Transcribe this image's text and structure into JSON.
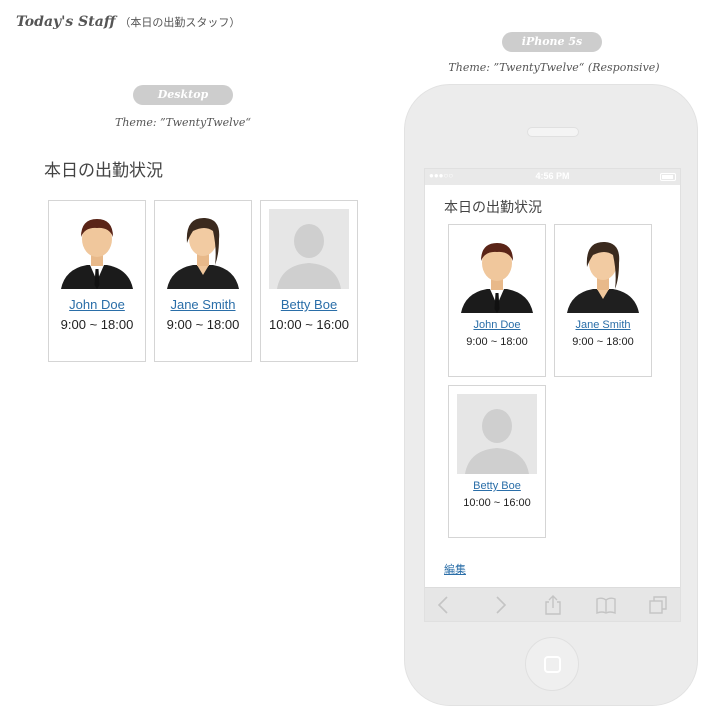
{
  "header": {
    "title": "Today's Staff",
    "subtitle": "（本日の出勤スタッフ）"
  },
  "desktop": {
    "pill_label": "Desktop",
    "theme_caption": "Theme: ”TwentyTwelve“",
    "heading": "本日の出勤状況",
    "staff": [
      {
        "name": "John Doe",
        "time": "9:00 ~ 18:00",
        "photo": "male-avatar"
      },
      {
        "name": "Jane Smith",
        "time": "9:00 ~ 18:00",
        "photo": "female-avatar"
      },
      {
        "name": "Betty Boe",
        "time": "10:00 ~ 16:00",
        "photo": "placeholder-avatar"
      }
    ]
  },
  "iphone": {
    "pill_label": "iPhone 5s",
    "theme_caption": "Theme: ”TwentyTwelve“ (Responsive)",
    "status_bar": {
      "signal": "●●●○○",
      "time": "4:56 PM"
    },
    "heading": "本日の出勤状況",
    "staff": [
      {
        "name": "John Doe",
        "time": "9:00 ~ 18:00",
        "photo": "male-avatar"
      },
      {
        "name": "Jane Smith",
        "time": "9:00 ~ 18:00",
        "photo": "female-avatar"
      },
      {
        "name": "Betty Boe",
        "time": "10:00 ~ 16:00",
        "photo": "placeholder-avatar"
      }
    ],
    "edit_link": "編集",
    "toolbar_icons": [
      "back-icon",
      "forward-icon",
      "share-icon",
      "bookmarks-icon",
      "tabs-icon"
    ]
  }
}
